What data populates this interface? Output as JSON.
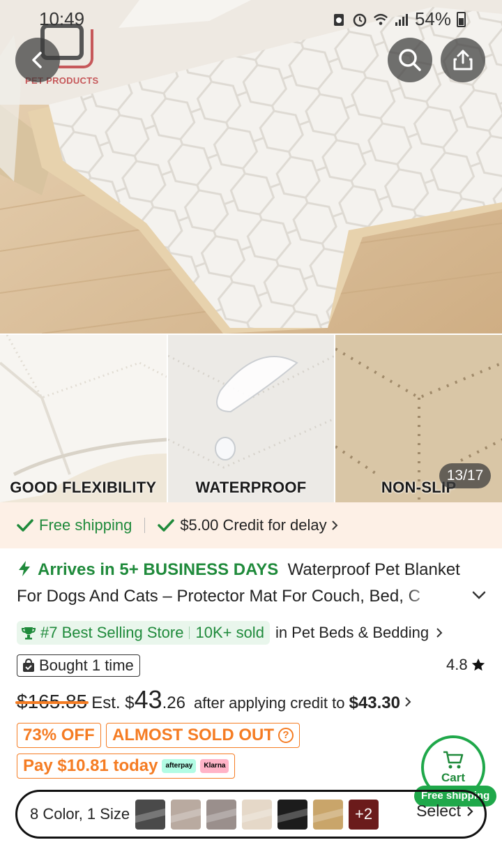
{
  "status_bar": {
    "time": "10:49",
    "battery": "54%"
  },
  "brand": {
    "logo_text": "PET PRODUCTS"
  },
  "gallery": {
    "counter": "13/17",
    "thumbnails": [
      {
        "label": "GOOD FLEXIBILITY"
      },
      {
        "label": "WATERPROOF"
      },
      {
        "label": "NON-SLIP"
      }
    ]
  },
  "shipping": {
    "free_shipping": "Free shipping",
    "credit": "$5.00 Credit for delay",
    "accent": "#1f8a3b"
  },
  "product": {
    "arrives": "Arrives in 5+ BUSINESS DAYS",
    "title": "Waterproof Pet Blanket For Dogs And Cats – Protector Mat For Couch, Bed, C"
  },
  "ranking": {
    "badge": "#7 Best Selling Store",
    "sold": "10K+ sold",
    "category": "in Pet Beds & Bedding"
  },
  "bought": {
    "label": "Bought 1 time"
  },
  "rating": {
    "value": "4.8"
  },
  "price": {
    "original": "$165.85",
    "est_label": "Est. $",
    "current_int": "43",
    "current_dec": ".26",
    "after_credit_label": "after applying credit to",
    "after_credit_value": "$43.30",
    "accent": "#f57c23"
  },
  "tags": {
    "discount": "73% OFF",
    "stock": "ALMOST SOLD OUT",
    "pay_today": "Pay $10.81 today",
    "afterpay": "afterpay",
    "klarna": "Klarna"
  },
  "cart": {
    "label": "Cart",
    "free_shipping": "Free shipping"
  },
  "variant": {
    "label": "8 Color, 1 Size",
    "more": "+2",
    "select": "Select",
    "swatch_colors": [
      "#4a4a4a",
      "#b9aaa0",
      "#9a8f8c",
      "#e5d8c8",
      "#1c1c1c",
      "#c9a56a"
    ]
  }
}
